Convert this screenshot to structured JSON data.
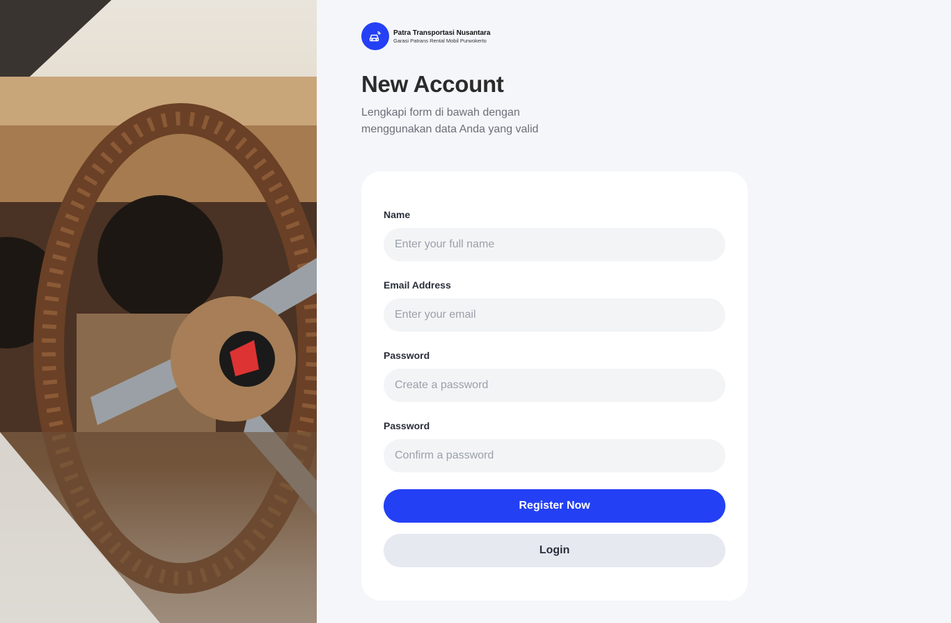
{
  "brand": {
    "name": "Patra Transportasi Nusantara",
    "tagline": "Garasi Patrans Rental Mobil Purwokerto",
    "logo_icon": "car-signal-icon",
    "accent": "#2340f5"
  },
  "hero": {
    "image_alt": "Classic car steering wheel"
  },
  "page": {
    "title": "New Account",
    "subtitle": "Lengkapi form di bawah dengan menggunakan data Anda yang valid"
  },
  "form": {
    "name": {
      "label": "Name",
      "placeholder": "Enter your full name",
      "value": ""
    },
    "email": {
      "label": "Email Address",
      "placeholder": "Enter your email",
      "value": ""
    },
    "password": {
      "label": "Password",
      "placeholder": "Create a password",
      "value": ""
    },
    "confirm_password": {
      "label": "Password",
      "placeholder": "Confirm a password",
      "value": ""
    },
    "register_label": "Register Now",
    "login_label": "Login"
  }
}
